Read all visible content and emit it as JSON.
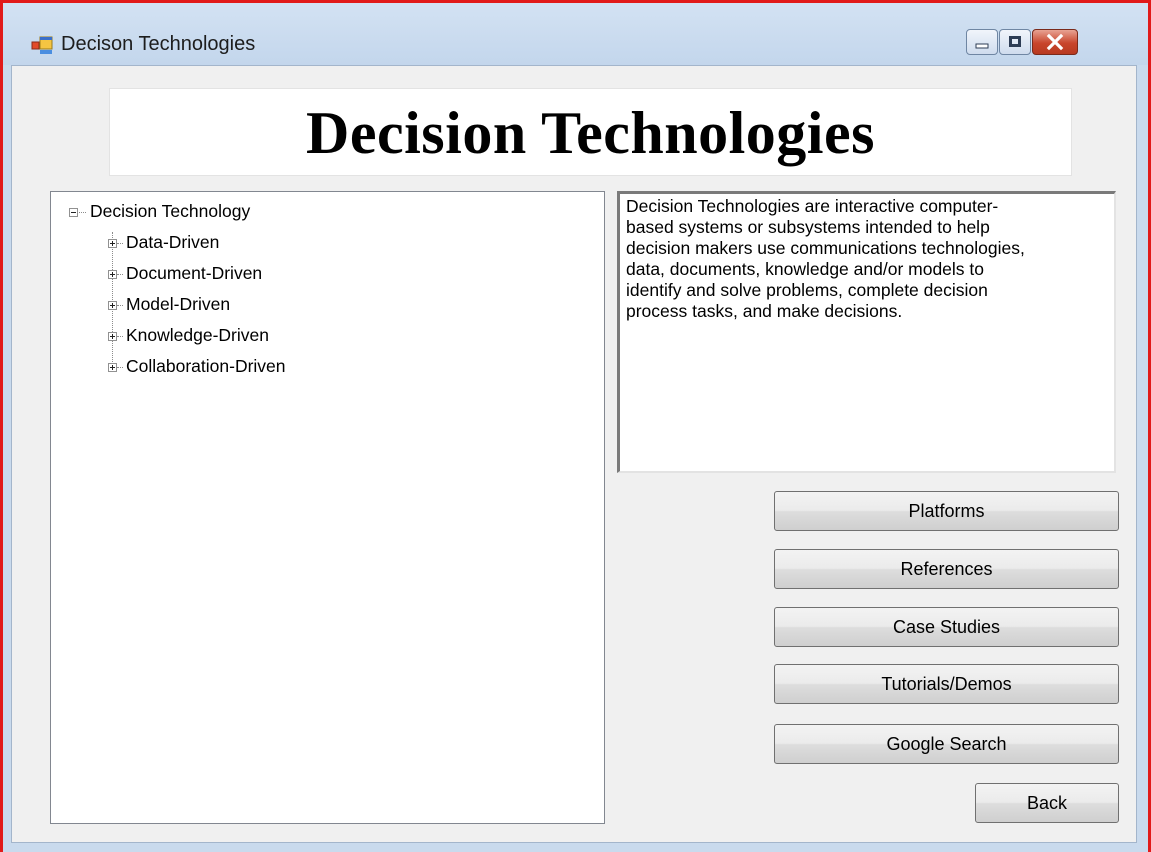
{
  "window": {
    "title": "Decison Technologies",
    "close_color": "#c8452c",
    "frame_color": "#e11a1a"
  },
  "banner": {
    "text": "Decision Technologies"
  },
  "tree": {
    "root": {
      "label": "Decision Technology",
      "expanded": true
    },
    "children": [
      {
        "label": "Data-Driven",
        "expanded": false
      },
      {
        "label": "Document-Driven",
        "expanded": false
      },
      {
        "label": "Model-Driven",
        "expanded": false
      },
      {
        "label": "Knowledge-Driven",
        "expanded": false
      },
      {
        "label": "Collaboration-Driven",
        "expanded": false
      }
    ]
  },
  "description": {
    "lines": [
      "Decision Technologies are interactive computer-",
      "based systems or subsystems intended to help",
      "decision makers use communications technologies,",
      "data, documents, knowledge and/or models to",
      "identify and solve problems, complete decision",
      "process tasks, and make decisions."
    ]
  },
  "buttons": {
    "platforms": "Platforms",
    "references": "References",
    "case_studies": "Case Studies",
    "tutorials": "Tutorials/Demos",
    "google_search": "Google Search",
    "back": "Back"
  },
  "icons": {
    "app": "app-window-icon",
    "minimize": "minimize-icon",
    "maximize": "maximize-icon",
    "close": "close-icon",
    "collapse": "minus-box-icon",
    "expand": "plus-box-icon"
  }
}
